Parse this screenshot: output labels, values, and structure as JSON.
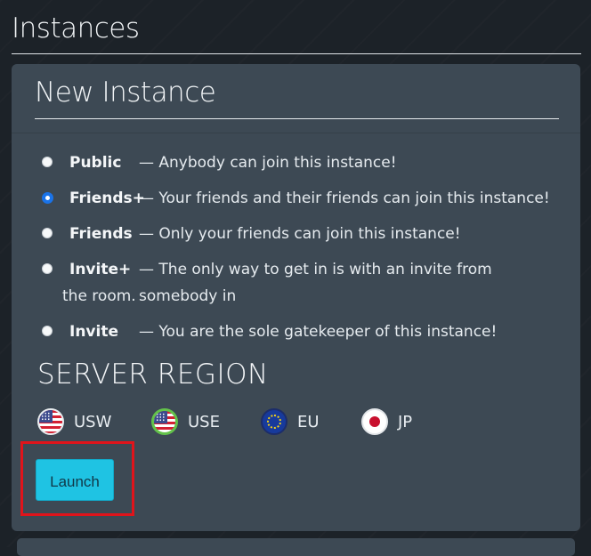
{
  "page": {
    "title": "Instances"
  },
  "panel": {
    "heading": "New Instance"
  },
  "options": [
    {
      "name": "Public",
      "desc": "— Anybody can join this instance!",
      "checked": false
    },
    {
      "name": "Friends+",
      "desc": "— Your friends and their friends can join this instance!",
      "checked": true
    },
    {
      "name": "Friends",
      "desc": "— Only your friends can join this instance!",
      "checked": false
    },
    {
      "name": "Invite+",
      "desc": "— The only way to get in is with an invite from somebody in",
      "wrap": "the room.",
      "checked": false
    },
    {
      "name": "Invite",
      "desc": "— You are the sole gatekeeper of this instance!",
      "checked": false
    }
  ],
  "server_region": {
    "title": "SERVER REGION",
    "regions": [
      {
        "code": "USW",
        "icon": "us-flag-icon",
        "selected": false
      },
      {
        "code": "USE",
        "icon": "us-flag-icon",
        "selected": true
      },
      {
        "code": "EU",
        "icon": "eu-flag-icon",
        "selected": false
      },
      {
        "code": "JP",
        "icon": "jp-flag-icon",
        "selected": false
      }
    ]
  },
  "launch": {
    "label": "Launch"
  },
  "colors": {
    "accent": "#1fc3e3",
    "radio_checked": "#1a73e8",
    "highlight": "#e0141b",
    "panel": "#3d4954",
    "background": "#1c2228"
  }
}
